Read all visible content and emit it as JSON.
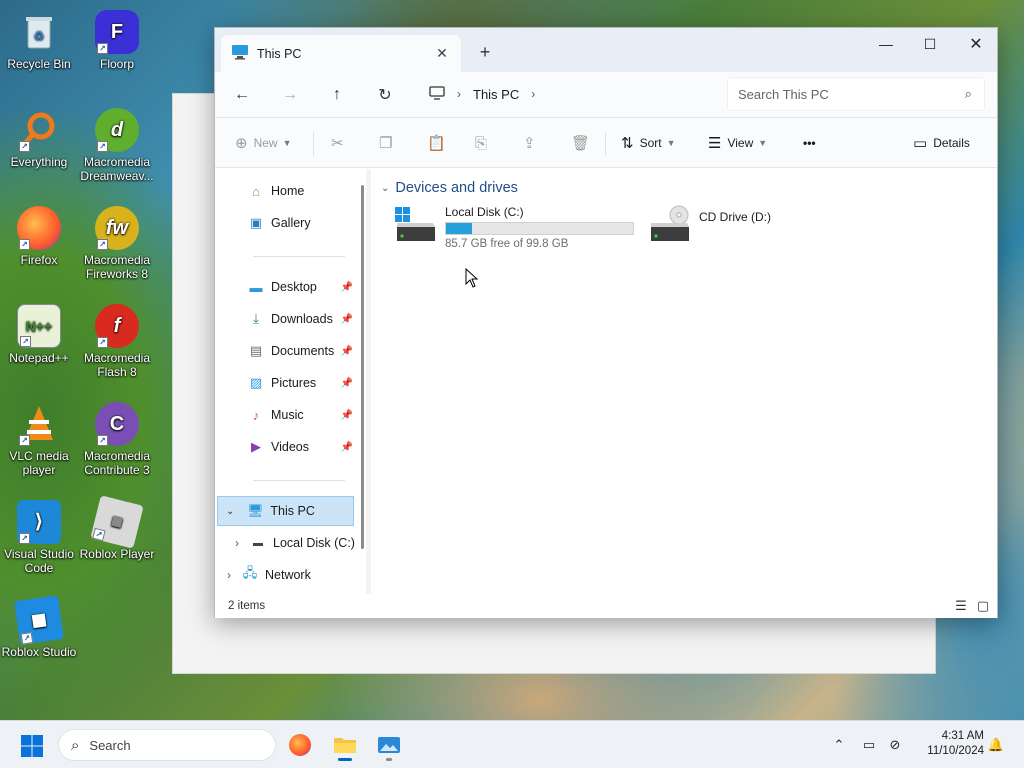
{
  "desktop": {
    "icons": [
      {
        "label": "Recycle Bin",
        "icon": "recycle-bin-icon"
      },
      {
        "label": "Floorp",
        "icon": "floorp-icon"
      },
      {
        "label": "Everything",
        "icon": "everything-search-icon"
      },
      {
        "label": "Macromedia Dreamweav...",
        "icon": "dreamweaver-icon"
      },
      {
        "label": "Firefox",
        "icon": "firefox-icon"
      },
      {
        "label": "Macromedia Fireworks 8",
        "icon": "fireworks-icon"
      },
      {
        "label": "Notepad++",
        "icon": "notepadpp-icon"
      },
      {
        "label": "Macromedia Flash 8",
        "icon": "flash-icon"
      },
      {
        "label": "VLC media player",
        "icon": "vlc-icon"
      },
      {
        "label": "Macromedia Contribute 3",
        "icon": "contribute-icon"
      },
      {
        "label": "Visual Studio Code",
        "icon": "vscode-icon"
      },
      {
        "label": "Roblox Player",
        "icon": "roblox-player-icon"
      },
      {
        "label": "Roblox Studio",
        "icon": "roblox-studio-icon"
      }
    ]
  },
  "window": {
    "tab_title": "This PC",
    "tab_close": "✕",
    "new_tab": "+",
    "minimize": "—",
    "maximize": "☐",
    "close": "✕"
  },
  "nav": {
    "address_segment": "This PC",
    "search_placeholder": "Search This PC"
  },
  "toolbar": {
    "new_label": "New",
    "sort_label": "Sort",
    "view_label": "View",
    "more_label": "•••",
    "details_label": "Details"
  },
  "sidebar": {
    "home": "Home",
    "gallery": "Gallery",
    "quick_access": [
      {
        "label": "Desktop",
        "icon": "desktop-folder-icon"
      },
      {
        "label": "Downloads",
        "icon": "download-arrow-icon"
      },
      {
        "label": "Documents",
        "icon": "documents-icon"
      },
      {
        "label": "Pictures",
        "icon": "pictures-icon"
      },
      {
        "label": "Music",
        "icon": "music-icon"
      },
      {
        "label": "Videos",
        "icon": "videos-icon"
      }
    ],
    "this_pc": "This PC",
    "local_disk": "Local Disk (C:)",
    "network": "Network"
  },
  "content": {
    "group_title": "Devices and drives",
    "drives": [
      {
        "name": "Local Disk (C:)",
        "free_text": "85.7 GB free of 99.8 GB",
        "used_fraction": 0.141
      },
      {
        "name": "CD Drive (D:)"
      }
    ]
  },
  "status": {
    "item_count": "2 items"
  },
  "taskbar": {
    "search_placeholder": "Search",
    "time": "4:31 AM",
    "date": "11/10/2024"
  },
  "colors": {
    "accent": "#0067c0",
    "drive_bar": "#26a0da",
    "selection": "#cce4f7"
  }
}
